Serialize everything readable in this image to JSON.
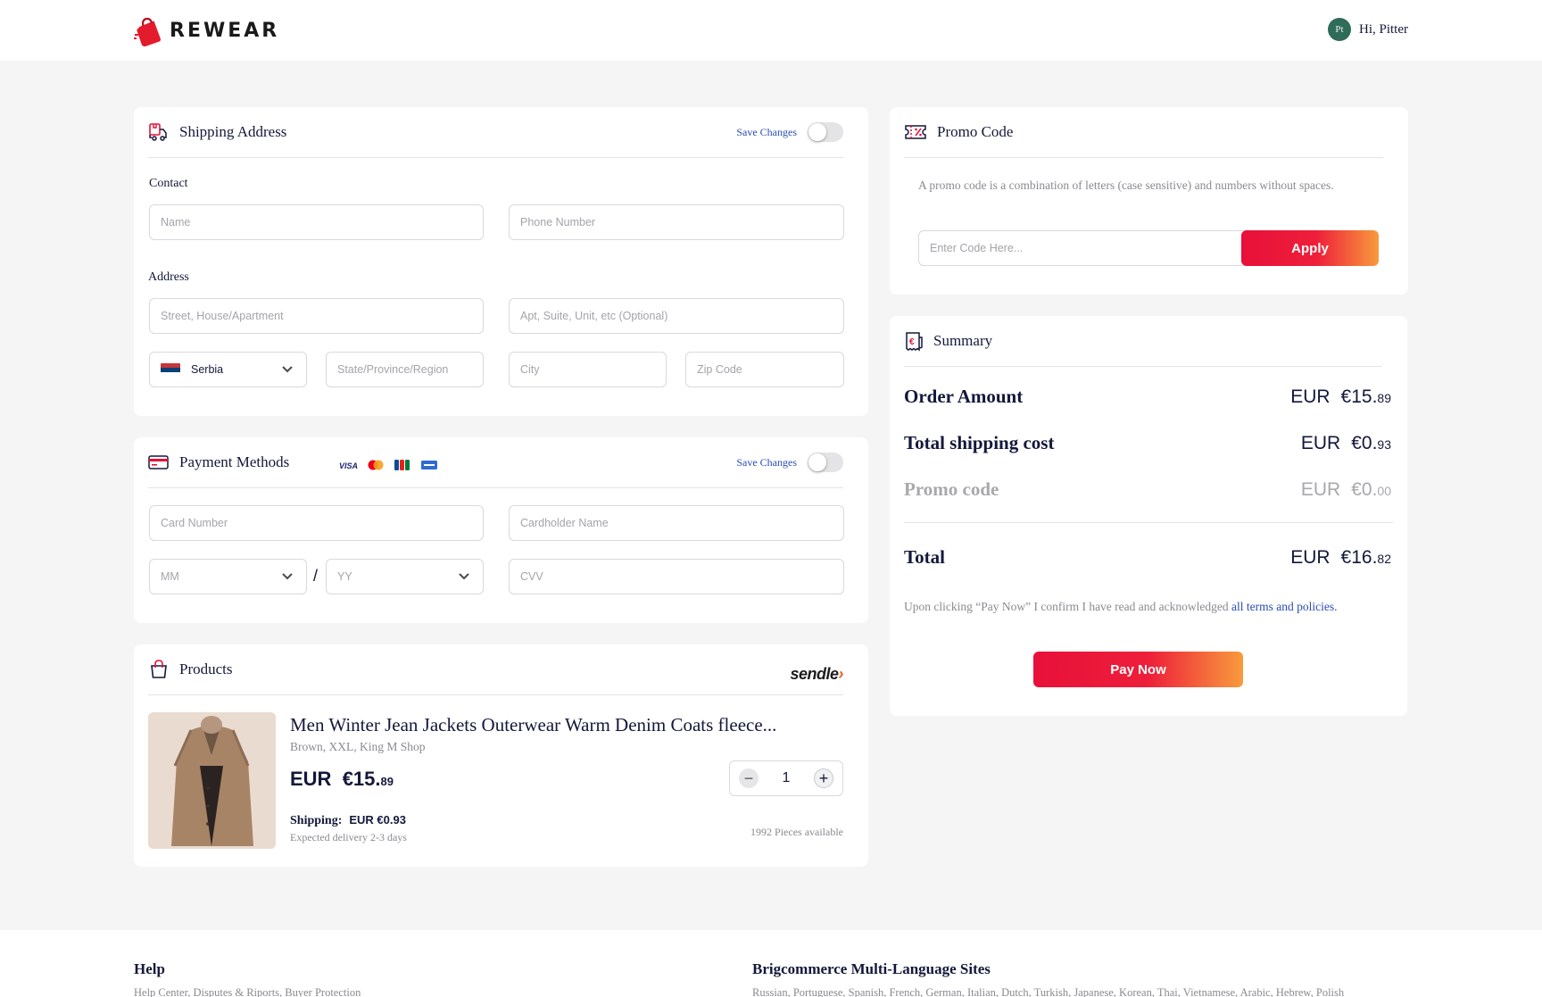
{
  "brand": {
    "name": "REWEAR"
  },
  "user": {
    "initials": "Pt",
    "greeting": "Hi, Pitter"
  },
  "shipping": {
    "title": "Shipping Address",
    "save_label": "Save Changes",
    "contact_label": "Contact",
    "address_label": "Address",
    "name_placeholder": "Name",
    "phone_placeholder": "Phone Number",
    "street_placeholder": "Street, House/Apartment",
    "apt_placeholder": "Apt, Suite, Unit, etc (Optional)",
    "country": "Serbia",
    "state_placeholder": "State/Province/Region",
    "city_placeholder": "City",
    "zip_placeholder": "Zip Code"
  },
  "payment": {
    "title": "Payment Methods",
    "save_label": "Save Changes",
    "card_brands": [
      "VISA",
      "Mastercard",
      "JCB",
      "Maestro"
    ],
    "card_number_placeholder": "Card Number",
    "cardholder_placeholder": "Cardholder Name",
    "month_placeholder": "MM",
    "separator": "/",
    "year_placeholder": "YY",
    "cvv_placeholder": "CVV"
  },
  "products": {
    "title": "Products",
    "carrier_main": "sendle",
    "carrier_mark": "›",
    "item": {
      "title": "Men Winter Jean Jackets Outerwear Warm Denim Coats fleece...",
      "variant": "Brown, XXL, King M Shop",
      "price_currency": "EUR",
      "price_main": "€15.",
      "price_cents": "89",
      "quantity": "1",
      "minus": "−",
      "plus": "+",
      "shipping_label": "Shipping:",
      "shipping_main": "EUR €0.",
      "shipping_cents": "93",
      "delivery": "Expected delivery 2-3 days",
      "available": "1992 Pieces available"
    }
  },
  "promo": {
    "title": "Promo Code",
    "description": "A promo code is a combination of letters (case sensitive) and numbers without spaces.",
    "input_placeholder": "Enter Code Here...",
    "apply_label": "Apply"
  },
  "summary": {
    "title": "Summary",
    "rows": [
      {
        "label": "Order Amount",
        "currency": "EUR",
        "main": "€15.",
        "cents": "89"
      },
      {
        "label": "Total shipping cost",
        "currency": "EUR",
        "main": "€0.",
        "cents": "93"
      },
      {
        "label": "Promo code",
        "currency": "EUR",
        "main": "€0.",
        "cents": "00"
      }
    ],
    "total": {
      "label": "Total",
      "currency": "EUR",
      "main": "€16.",
      "cents": "82"
    },
    "terms_text": "Upon clicking “Pay Now” I confirm I have read and acknowledged ",
    "terms_link": "all terms and policies.",
    "pay_label": "Pay Now"
  },
  "footer": {
    "help_title": "Help",
    "help_links": "Help Center, Disputes & Riports, Buyer Protection",
    "sites_title": "Brigcommerce Multi-Language Sites",
    "sites_links": "Russian, Portuguese, Spanish, French, German, Italian, Dutch, Turkish, Japanese, Korean, Thai, Vietnamese, Arabic, Hebrew, Polish"
  },
  "colors": {
    "accent_start": "#e8103a",
    "accent_end": "#f89b3c",
    "navy": "#14183a",
    "link": "#2a4bb5"
  }
}
